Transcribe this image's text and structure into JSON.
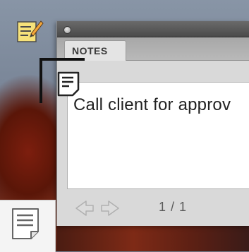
{
  "toolbar": {
    "tool_icon": "note-pencil-icon"
  },
  "palette": {
    "tab_label": "NOTES",
    "note_text": "Call client for approv",
    "page_indicator": "1 / 1",
    "prev_icon": "arrow-left-icon",
    "next_icon": "arrow-right-icon"
  },
  "canvas": {
    "marker_icon": "note-icon"
  },
  "tools": {
    "note_tool_icon": "note-tool-icon"
  }
}
